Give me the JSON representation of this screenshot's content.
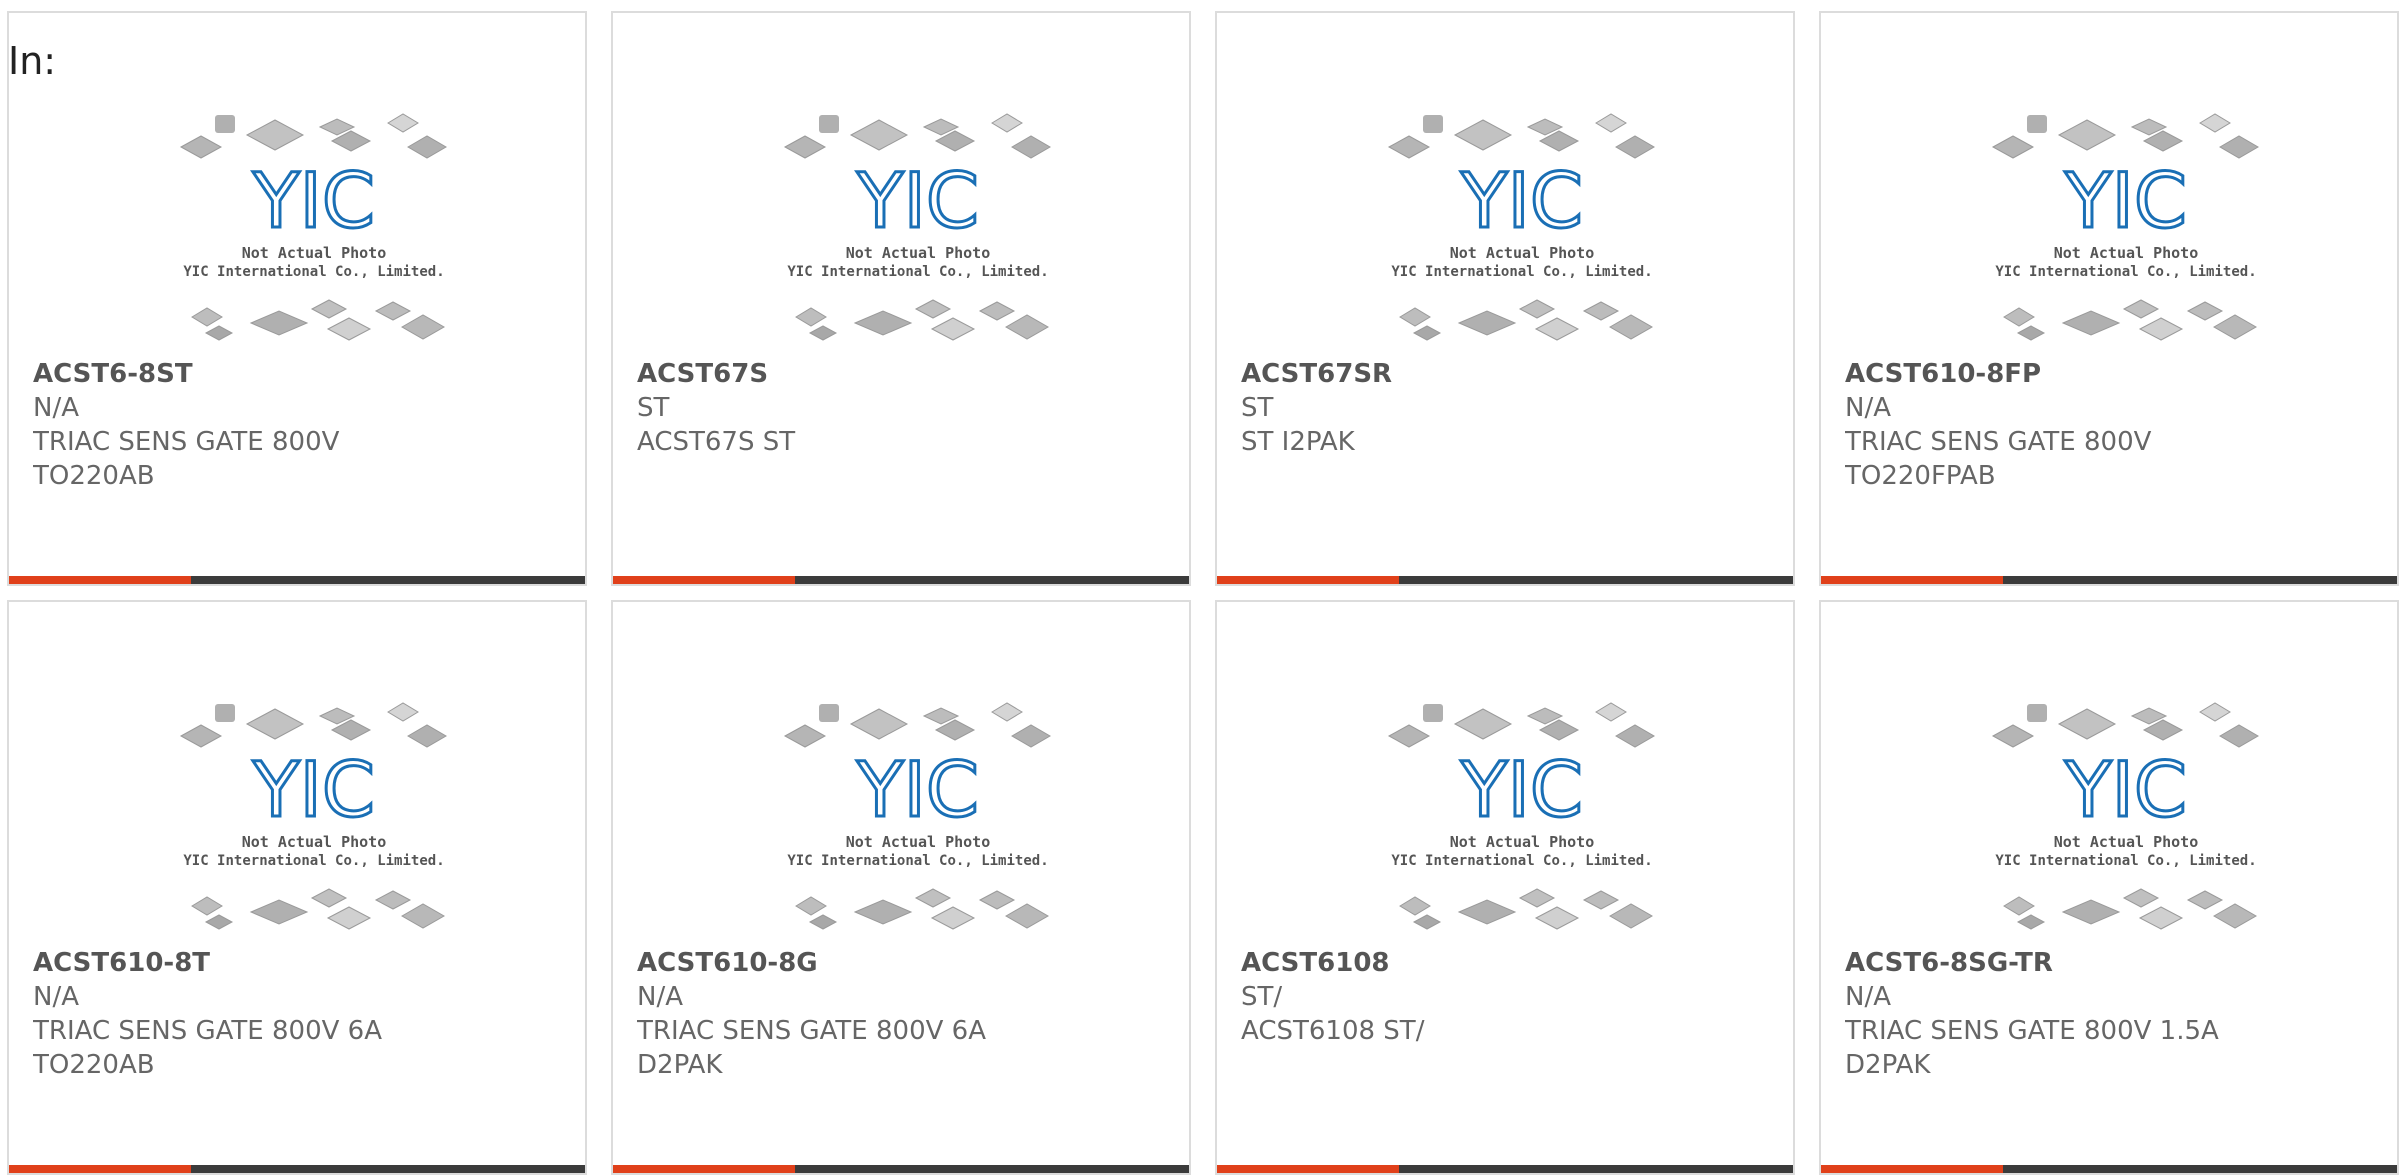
{
  "header": {
    "in_label": "In:"
  },
  "photo": {
    "brand": "YIC",
    "line1": "Not Actual Photo",
    "line2": "YIC International Co., Limited."
  },
  "colors": {
    "accent": "#e0401a",
    "bar": "#3b3b3b",
    "logo": "#1a6fb5",
    "text": "#666666"
  },
  "products": [
    {
      "part_number": "ACST6-8ST",
      "manufacturer": "N/A",
      "desc1": "TRIAC SENS GATE 800V",
      "desc2": "TO220AB"
    },
    {
      "part_number": "ACST67S",
      "manufacturer": "ST",
      "desc1": "ACST67S ST",
      "desc2": ""
    },
    {
      "part_number": "ACST67SR",
      "manufacturer": "ST",
      "desc1": "ST I2PAK",
      "desc2": ""
    },
    {
      "part_number": "ACST610-8FP",
      "manufacturer": "N/A",
      "desc1": "TRIAC SENS GATE 800V",
      "desc2": "TO220FPAB"
    },
    {
      "part_number": "ACST610-8T",
      "manufacturer": "N/A",
      "desc1": "TRIAC SENS GATE 800V 6A",
      "desc2": "TO220AB"
    },
    {
      "part_number": "ACST610-8G",
      "manufacturer": "N/A",
      "desc1": "TRIAC SENS GATE 800V 6A",
      "desc2": "D2PAK"
    },
    {
      "part_number": "ACST6108",
      "manufacturer": "ST/",
      "desc1": "ACST6108 ST/",
      "desc2": ""
    },
    {
      "part_number": "ACST6-8SG-TR",
      "manufacturer": "N/A",
      "desc1": "TRIAC SENS GATE 800V 1.5A",
      "desc2": "D2PAK"
    }
  ]
}
